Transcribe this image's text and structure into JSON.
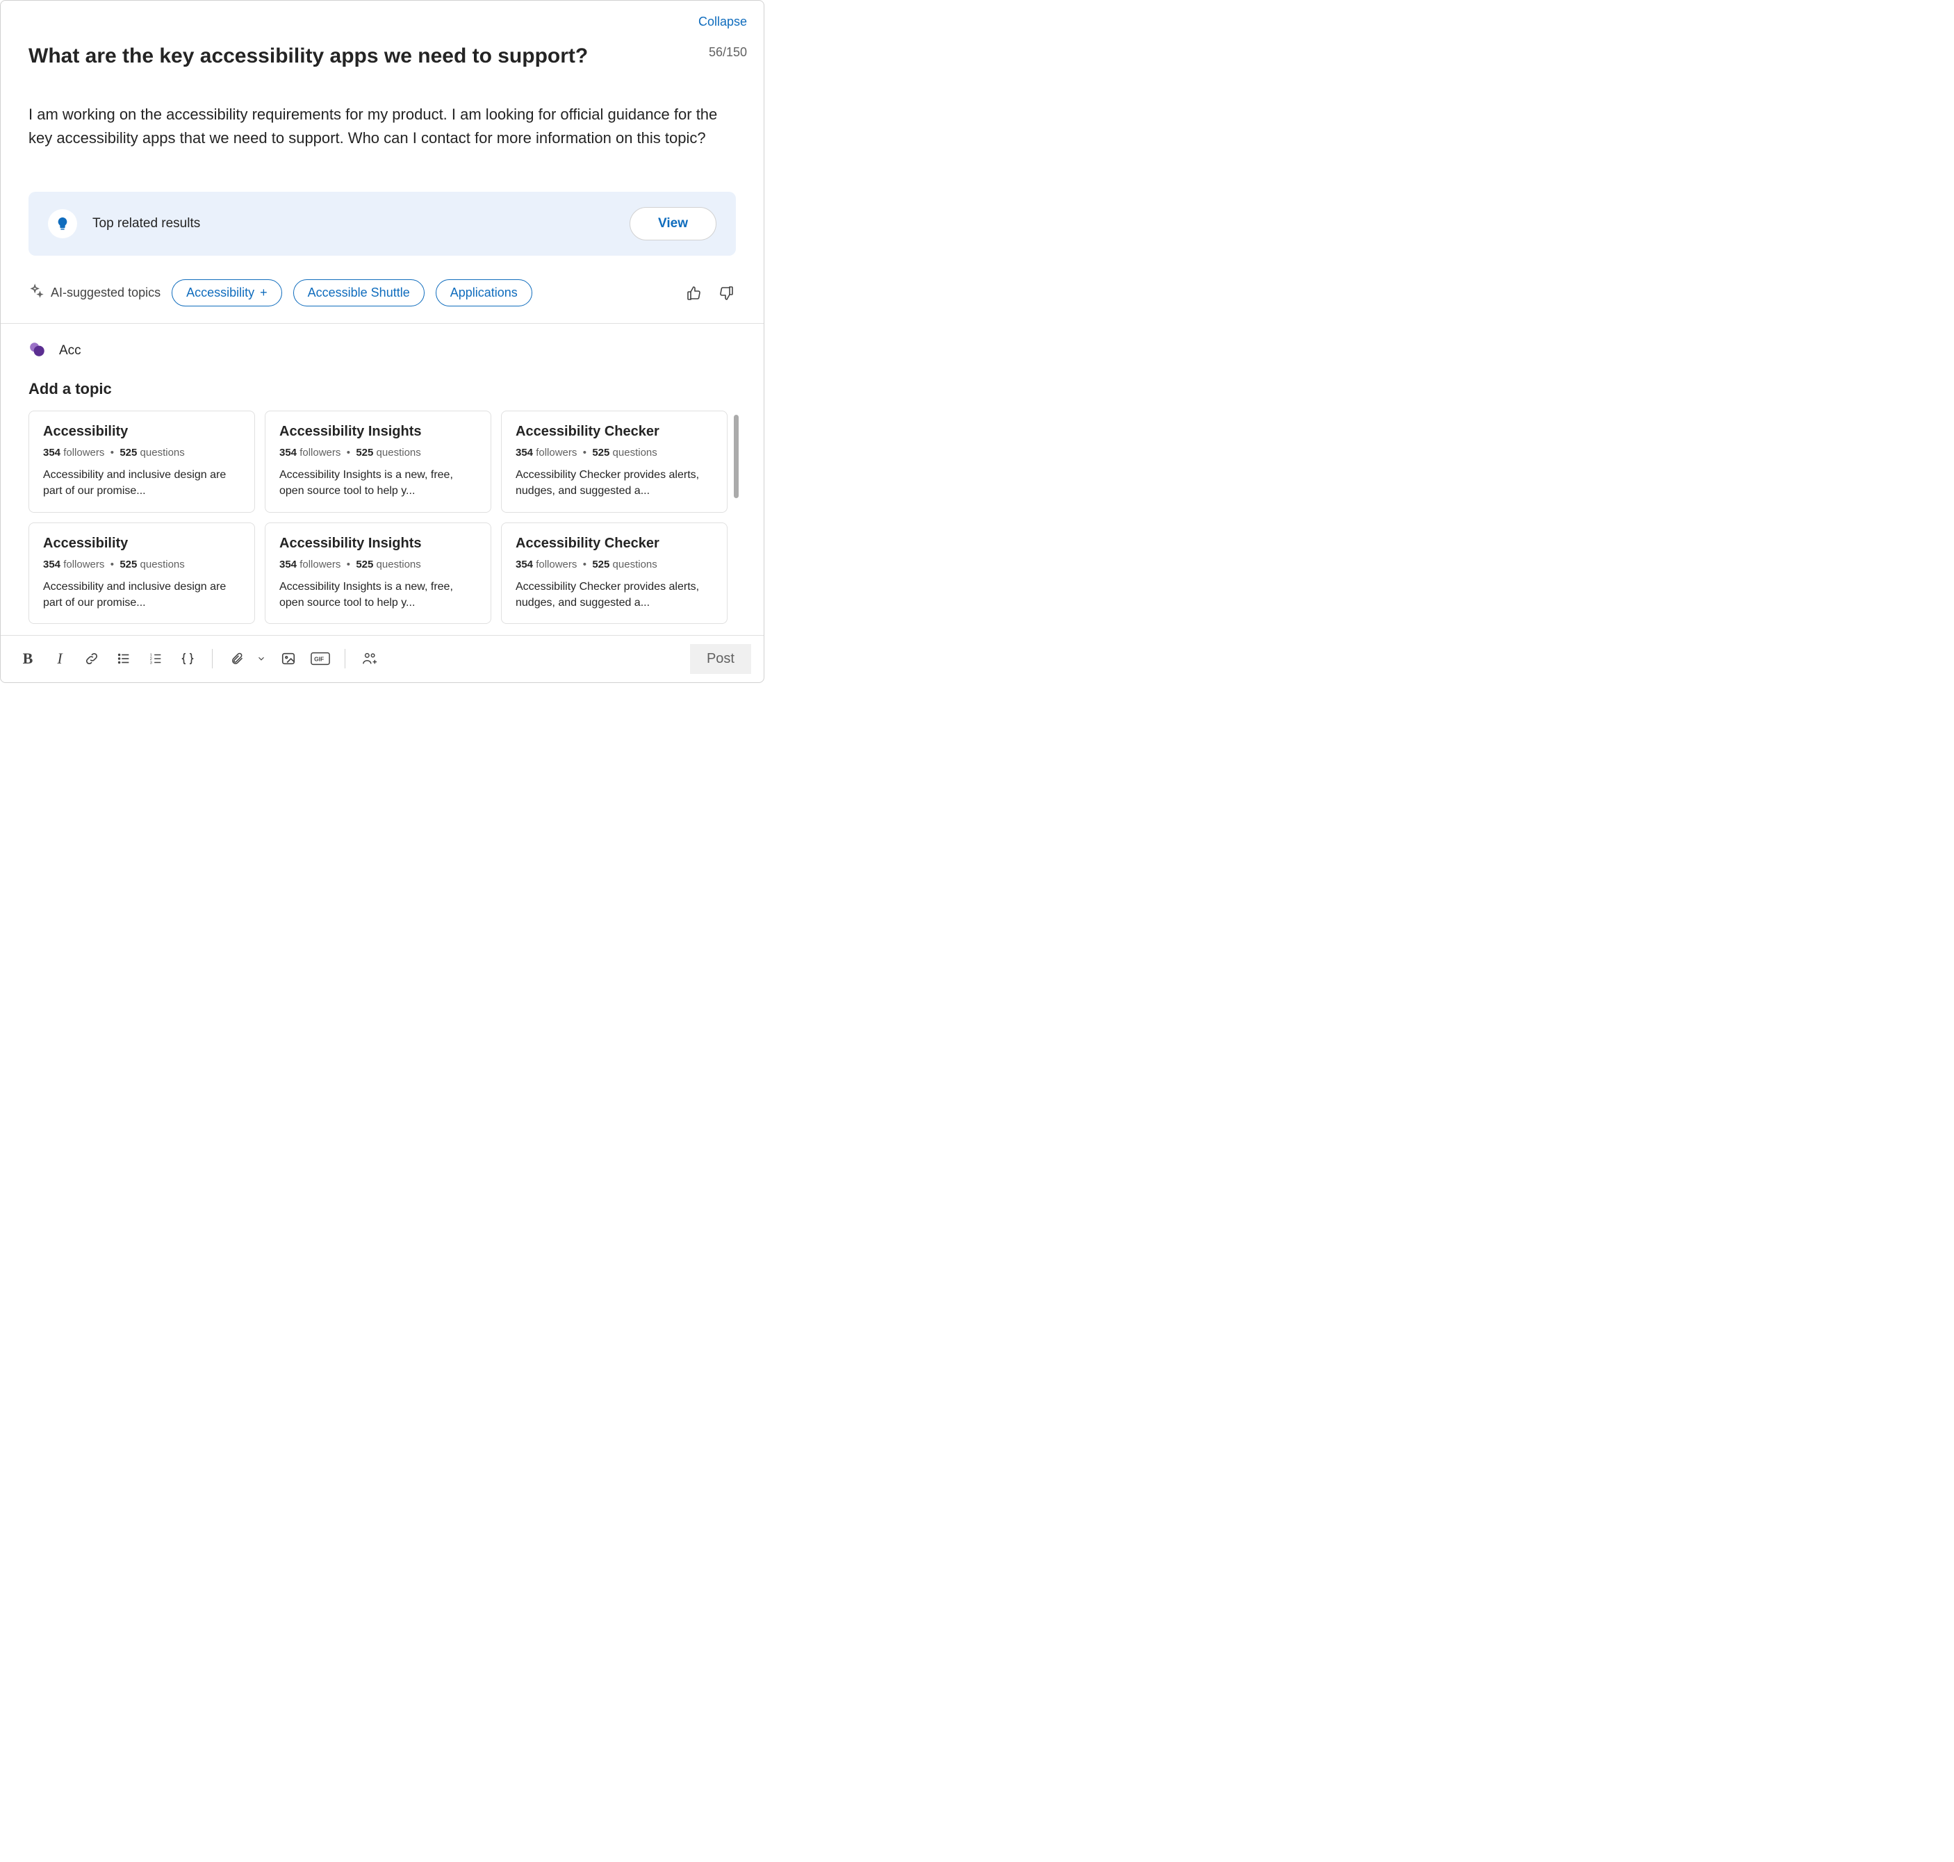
{
  "header": {
    "collapse_label": "Collapse",
    "char_counter": "56/150"
  },
  "post": {
    "title": "What are the key accessibility apps we need to support?",
    "body": "I am working on the accessibility requirements for my product. I am looking for official guidance for the key accessibility apps that we need to support. Who can I contact for more information on this topic?"
  },
  "top_related": {
    "label": "Top related results",
    "view_label": "View"
  },
  "ai_suggested": {
    "label": "AI-suggested topics",
    "chips": [
      {
        "label": "Accessibility",
        "has_plus": true
      },
      {
        "label": "Accessible Shuttle",
        "has_plus": false
      },
      {
        "label": "Applications",
        "has_plus": false
      }
    ]
  },
  "topic_search": {
    "value": "Acc",
    "add_heading": "Add a topic"
  },
  "topic_cards": [
    {
      "title": "Accessibility",
      "followers": "354",
      "questions": "525",
      "desc": "Accessibility and inclusive design are part of our promise..."
    },
    {
      "title": "Accessibility Insights",
      "followers": "354",
      "questions": "525",
      "desc": "Accessibility Insights is a new, free, open source tool to help y..."
    },
    {
      "title": "Accessibility Checker",
      "followers": "354",
      "questions": "525",
      "desc": "Accessibility Checker provides alerts, nudges, and suggested a..."
    },
    {
      "title": "Accessibility",
      "followers": "354",
      "questions": "525",
      "desc": "Accessibility and inclusive design are part of our promise..."
    },
    {
      "title": "Accessibility Insights",
      "followers": "354",
      "questions": "525",
      "desc": "Accessibility Insights is a new, free, open source tool to help y..."
    },
    {
      "title": "Accessibility Checker",
      "followers": "354",
      "questions": "525",
      "desc": "Accessibility Checker provides alerts, nudges, and suggested a..."
    }
  ],
  "labels": {
    "followers": "followers",
    "questions": "questions",
    "bullet": "•"
  },
  "toolbar": {
    "post_label": "Post"
  }
}
